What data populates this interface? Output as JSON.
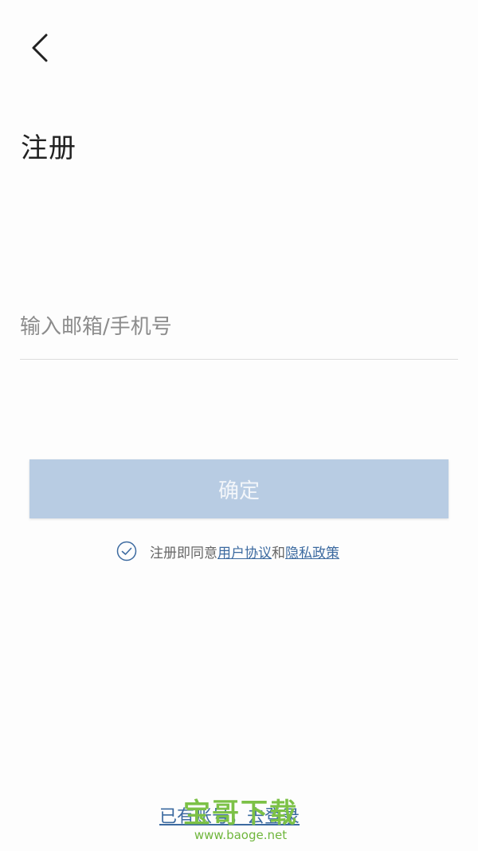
{
  "header": {
    "back_icon": "chevron-left-icon",
    "title": "注册"
  },
  "form": {
    "account_placeholder": "输入邮箱/手机号",
    "account_value": "",
    "confirm_label": "确定"
  },
  "agreement": {
    "check_icon": "check-circle-icon",
    "prefix": "注册即同意",
    "user_agreement": "用户协议",
    "and": "和",
    "privacy_policy": "隐私政策"
  },
  "footer": {
    "login_link": "已有账号，去登录"
  },
  "watermark": {
    "name": "宝哥下载",
    "url": "www.baoge.net"
  },
  "colors": {
    "accent": "#3c6aa0",
    "button_disabled": "#b8cce3",
    "watermark": "#7cc146"
  }
}
